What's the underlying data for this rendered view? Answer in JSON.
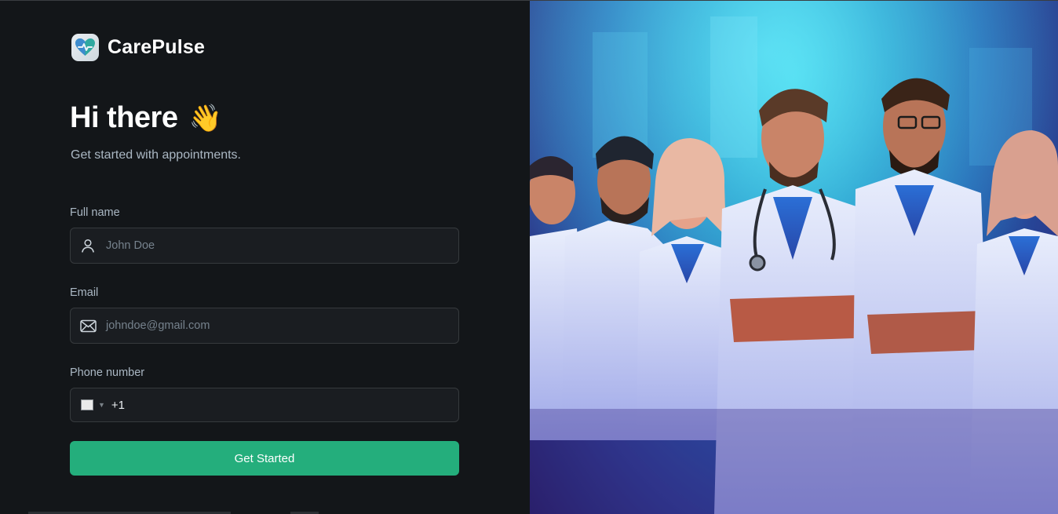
{
  "brand": {
    "name": "CarePulse",
    "logo_icon": "heart-pulse-icon"
  },
  "heading": {
    "title": "Hi there",
    "emoji": "👋",
    "subtitle": "Get started with appointments."
  },
  "form": {
    "full_name": {
      "label": "Full name",
      "placeholder": "John Doe",
      "icon": "user-icon"
    },
    "email": {
      "label": "Email",
      "placeholder": "johndoe@gmail.com",
      "icon": "mail-icon"
    },
    "phone": {
      "label": "Phone number",
      "country_code": "+1",
      "icon": "flag-icon"
    },
    "submit_label": "Get Started"
  },
  "colors": {
    "background": "#131619",
    "accent": "#24ae7c",
    "input_bg": "#1a1d21",
    "border": "#363a3d",
    "muted_text": "#abb8c4"
  },
  "hero_image": {
    "subject": "illustrated team of doctors in white coats with stethoscopes"
  }
}
